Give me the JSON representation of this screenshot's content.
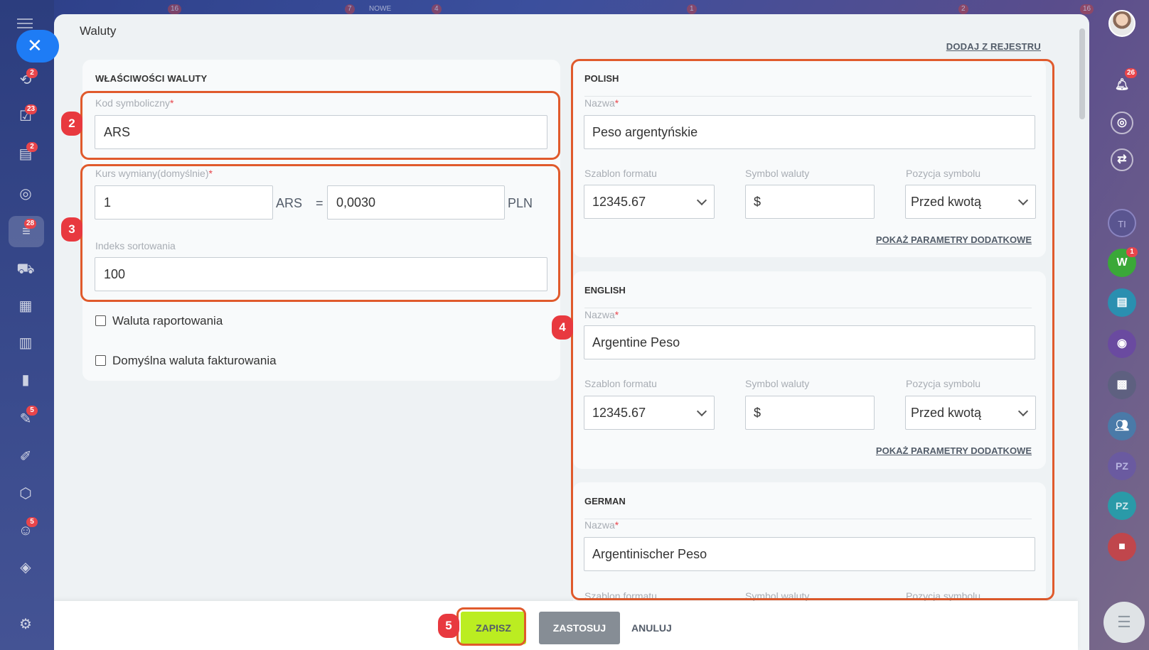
{
  "modal": {
    "title": "Waluty",
    "registry_link": "DODAJ Z REJESTRU"
  },
  "top_counters": [
    "16",
    "7",
    "NOWE",
    "4",
    "1",
    "2",
    "16"
  ],
  "left_sidebar": {
    "items": [
      {
        "icon": "flow-icon",
        "badge": "2"
      },
      {
        "icon": "tasks-icon",
        "badge": "23"
      },
      {
        "icon": "contacts-icon",
        "badge": "2"
      },
      {
        "icon": "target-icon",
        "badge": ""
      },
      {
        "icon": "filter-icon",
        "badge": "28"
      },
      {
        "icon": "cart-icon",
        "badge": ""
      },
      {
        "icon": "store-icon",
        "badge": ""
      },
      {
        "icon": "calendar-icon",
        "badge": ""
      },
      {
        "icon": "chart-icon",
        "badge": ""
      },
      {
        "icon": "document-icon",
        "badge": "5"
      },
      {
        "icon": "pen-icon",
        "badge": ""
      },
      {
        "icon": "hexagon-icon",
        "badge": ""
      },
      {
        "icon": "robot-icon",
        "badge": "5"
      },
      {
        "icon": "box-icon",
        "badge": ""
      },
      {
        "icon": "gear-icon",
        "badge": ""
      }
    ]
  },
  "right_sidebar": {
    "notifications_badge": "26",
    "items": [
      "TI",
      "W",
      "PZ",
      "PZ"
    ],
    "w_badge": "1"
  },
  "properties": {
    "section_title": "WŁAŚCIWOŚCI WALUTY",
    "code_label": "Kod symboliczny",
    "code_value": "ARS",
    "rate_label": "Kurs wymiany(domyślnie)",
    "rate_amount": "1",
    "rate_currency": "ARS",
    "equals": "=",
    "rate_value": "0,0030",
    "base_currency": "PLN",
    "sort_label": "Indeks sortowania",
    "sort_value": "100",
    "checkbox_reporting": "Waluta raportowania",
    "checkbox_invoice": "Domyślna waluta fakturowania"
  },
  "required_mark": "*",
  "languages": [
    {
      "title": "POLISH",
      "name_label": "Nazwa",
      "name_value": "Peso argentyńskie",
      "format_label": "Szablon formatu",
      "format_value": "12345.67",
      "symbol_label": "Symbol waluty",
      "symbol_value": "$",
      "position_label": "Pozycja symbolu",
      "position_value": "Przed kwotą",
      "params_link": "POKAŻ PARAMETRY DODATKOWE"
    },
    {
      "title": "ENGLISH",
      "name_label": "Nazwa",
      "name_value": "Argentine Peso",
      "format_label": "Szablon formatu",
      "format_value": "12345.67",
      "symbol_label": "Symbol waluty",
      "symbol_value": "$",
      "position_label": "Pozycja symbolu",
      "position_value": "Przed kwotą",
      "params_link": "POKAŻ PARAMETRY DODATKOWE"
    },
    {
      "title": "GERMAN",
      "name_label": "Nazwa",
      "name_value": "Argentinischer Peso",
      "format_label": "Szablon formatu",
      "symbol_label": "Symbol waluty",
      "position_label": "Pozycja symbolu"
    }
  ],
  "markers": [
    "2",
    "3",
    "4",
    "5"
  ],
  "footer": {
    "save": "ZAPISZ",
    "apply": "ZASTOSUJ",
    "cancel": "ANULUJ"
  },
  "colors": {
    "accent_blue": "#1e7cf5",
    "save_green": "#bbed21",
    "annotation_orange": "#e05a2c",
    "marker_red": "#e8393f",
    "badge_red": "#e8454b"
  }
}
